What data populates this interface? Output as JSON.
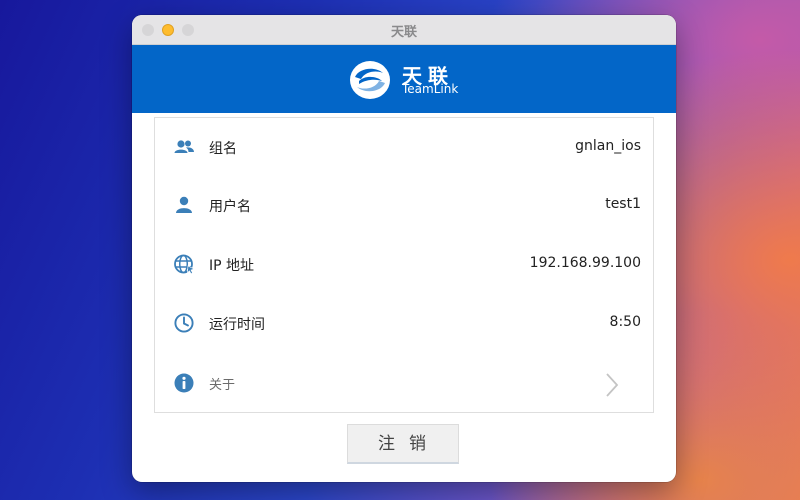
{
  "window": {
    "title": "天联"
  },
  "brand": {
    "name_cn": "天联",
    "name_en": "TeamLink",
    "logo": "teamlink-logo"
  },
  "rows": [
    {
      "icon": "group-icon",
      "label": "组名",
      "value": "gnlan_ios"
    },
    {
      "icon": "user-icon",
      "label": "用户名",
      "value": "test1"
    },
    {
      "icon": "globe-icon",
      "label": "IP 地址",
      "value": "192.168.99.100"
    },
    {
      "icon": "clock-icon",
      "label": "运行时间",
      "value": "8:50"
    },
    {
      "icon": "info-icon",
      "label": "关于",
      "value": ""
    }
  ],
  "buttons": {
    "logout": "注销"
  },
  "colors": {
    "brand_blue": "#0366c8",
    "icon_blue": "#3b7fb8",
    "minimize_yellow": "#febc2e"
  }
}
